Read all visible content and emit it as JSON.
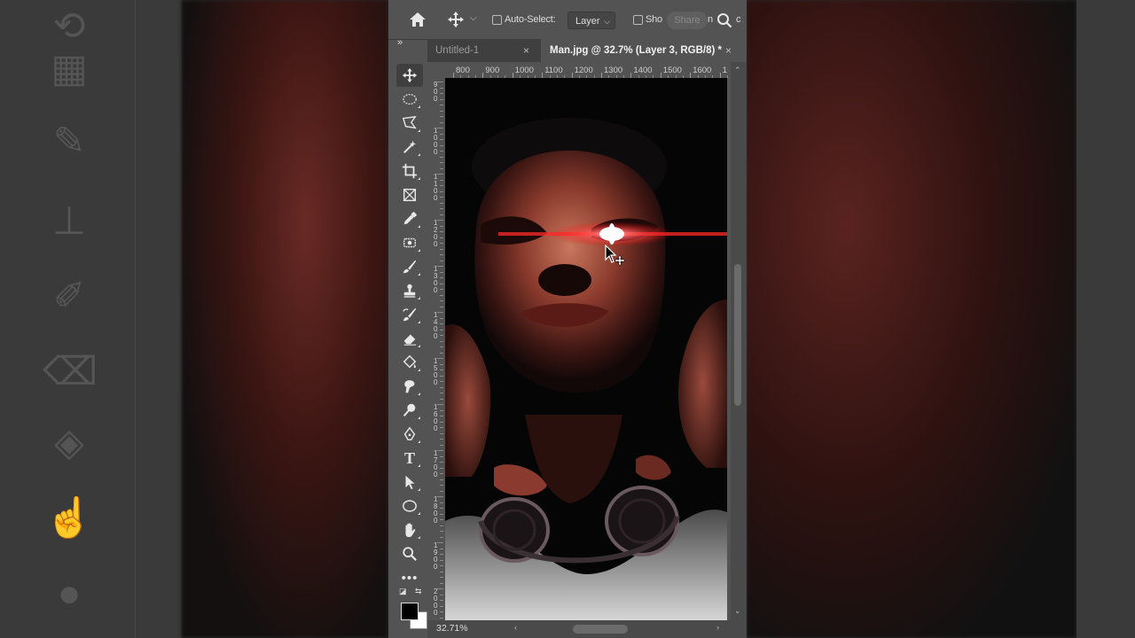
{
  "options_bar": {
    "auto_select_label": "Auto-Select:",
    "layer_select": "Layer",
    "show_label": "Sho",
    "overflow_label": "n",
    "share_label": "Share",
    "trailing": "c"
  },
  "tabs": [
    {
      "label": "Untitled-1"
    },
    {
      "label": "Man.jpg @ 32.7% (Layer 3, RGB/8) *"
    }
  ],
  "ruler": {
    "horizontal": [
      "800",
      "900",
      "1000",
      "1100",
      "1200",
      "1300",
      "1400",
      "1500",
      "1600",
      "1"
    ],
    "vertical": [
      {
        "digits": "900"
      },
      {
        "digits": "1000"
      },
      {
        "digits": "1100"
      },
      {
        "digits": "1200"
      },
      {
        "digits": "1300"
      },
      {
        "digits": "1400"
      },
      {
        "digits": "1500"
      },
      {
        "digits": "1600"
      },
      {
        "digits": "1700"
      },
      {
        "digits": "1800"
      },
      {
        "digits": "1900"
      },
      {
        "digits": "2000"
      }
    ]
  },
  "status": {
    "zoom": "32.71%"
  },
  "colors": {
    "foreground": "#000000",
    "background": "#ffffff",
    "panel": "#535353"
  }
}
